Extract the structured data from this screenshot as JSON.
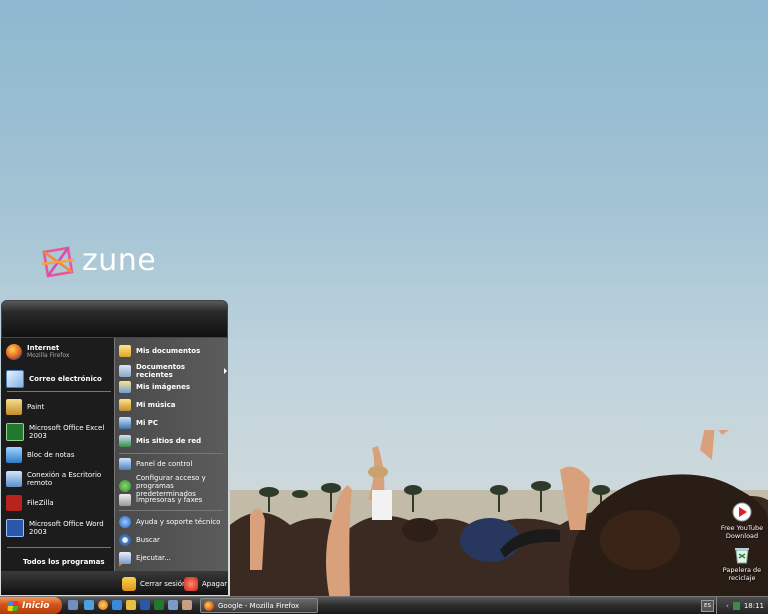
{
  "desktop": {
    "logo_text": "zune",
    "icons": [
      {
        "label": "Free YouTube Download",
        "icon": "youtube-download-icon"
      },
      {
        "label": "Papelera de reciclaje",
        "icon": "recycle-bin-icon"
      }
    ]
  },
  "start_menu": {
    "pinned": [
      {
        "title": "Internet",
        "subtitle": "Mozilla Firefox",
        "icon": "firefox-icon"
      },
      {
        "title": "Correo electrónico",
        "icon": "mail-icon"
      }
    ],
    "recent": [
      {
        "label": "Paint",
        "icon": "paint-icon"
      },
      {
        "label": "Microsoft Office Excel 2003",
        "icon": "excel-icon"
      },
      {
        "label": "Bloc de notas",
        "icon": "notepad-icon"
      },
      {
        "label": "Conexión a Escritorio remoto",
        "icon": "remote-desktop-icon"
      },
      {
        "label": "FileZilla",
        "icon": "filezilla-icon"
      },
      {
        "label": "Microsoft Office Word 2003",
        "icon": "word-icon"
      }
    ],
    "all_programs": "Todos los programas",
    "places": [
      {
        "label": "Mis documentos",
        "icon": "documents-icon"
      },
      {
        "label": "Documentos recientes",
        "icon": "recent-documents-icon"
      },
      {
        "label": "Mis imágenes",
        "icon": "pictures-icon"
      },
      {
        "label": "Mi música",
        "icon": "music-icon"
      },
      {
        "label": "Mi PC",
        "icon": "computer-icon"
      },
      {
        "label": "Mis sitios de red",
        "icon": "network-icon"
      }
    ],
    "system": [
      {
        "label": "Panel de control",
        "icon": "control-panel-icon"
      },
      {
        "label": "Configurar acceso y programas predeterminados",
        "icon": "default-programs-icon"
      },
      {
        "label": "Impresoras y faxes",
        "icon": "printer-icon"
      }
    ],
    "help": [
      {
        "label": "Ayuda y soporte técnico",
        "icon": "help-icon"
      },
      {
        "label": "Buscar",
        "icon": "search-icon"
      },
      {
        "label": "Ejecutar...",
        "icon": "run-icon"
      }
    ],
    "logoff": "Cerrar sesión",
    "shutdown": "Apagar"
  },
  "taskbar": {
    "start_label": "Inicio",
    "task_label": "Google - Mozilla Firefox",
    "language": "ES",
    "clock": "18:11"
  },
  "colors": {
    "start_orange": "#d2541a",
    "sky": "#a3c3d3",
    "menu_dark": "#1c1c1c"
  }
}
